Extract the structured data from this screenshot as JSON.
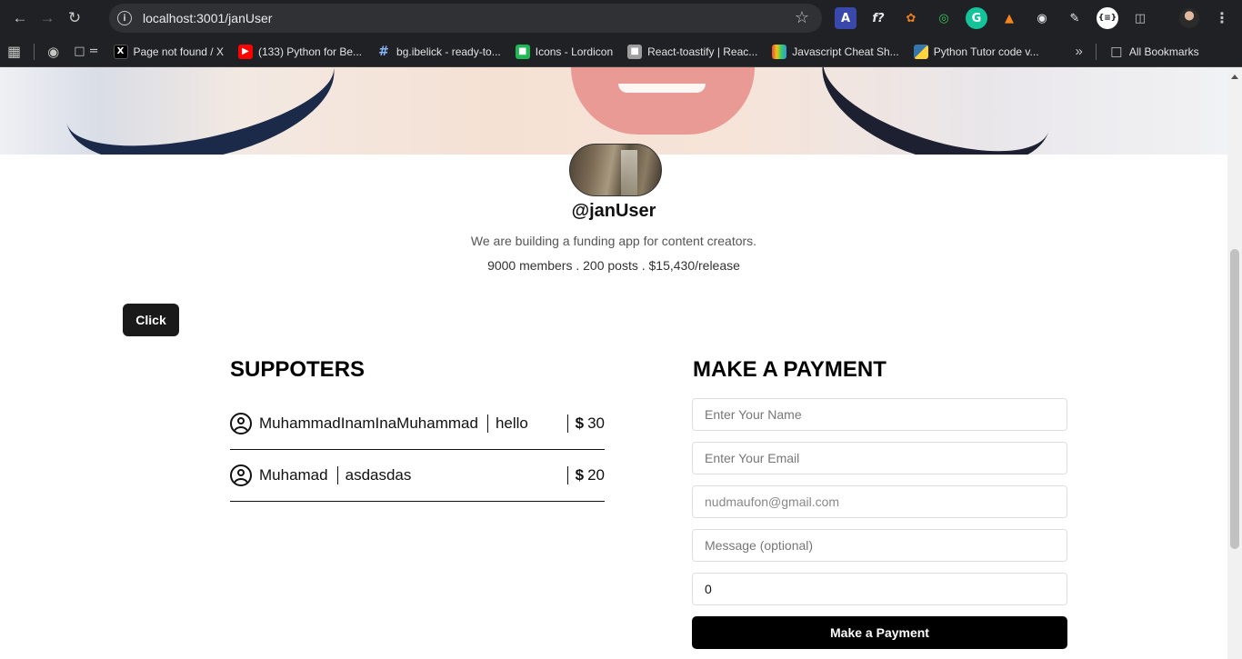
{
  "browser": {
    "url": "localhost:3001/janUser",
    "bookmarks": [
      {
        "label": "Page not found / X",
        "icon": "x-logo-icon"
      },
      {
        "label": "(133) Python for Be...",
        "icon": "youtube-icon"
      },
      {
        "label": "bg.ibelick - ready-to...",
        "icon": "hash-icon"
      },
      {
        "label": "Icons - Lordicon",
        "icon": "lordicon-icon"
      },
      {
        "label": "React-toastify | Reac...",
        "icon": "toastify-icon"
      },
      {
        "label": "Javascript Cheat Sh...",
        "icon": "cheatsheet-icon"
      },
      {
        "label": "Python Tutor code v...",
        "icon": "python-icon"
      }
    ],
    "more_label": "»",
    "all_bookmarks": "All Bookmarks"
  },
  "profile": {
    "handle": "@janUser",
    "bio": "We are building a funding app for content creators.",
    "stats": "9000 members . 200 posts . $15,430/release"
  },
  "click_button": "Click",
  "supporters": {
    "title": "SUPPOTERS",
    "rows": [
      {
        "name": "MuhammadInamInaMuhammad",
        "message": "hello",
        "amount": "30"
      },
      {
        "name": "Muhamad",
        "message": "asdasdas",
        "amount": "20"
      }
    ],
    "currency": "$"
  },
  "payment": {
    "title": "MAKE A PAYMENT",
    "name_placeholder": "Enter Your Name",
    "email_placeholder": "Enter Your Email",
    "email_value": "nudmaufon@gmail.com",
    "message_placeholder": "Message (optional)",
    "amount_value": "0",
    "button": "Make a Payment"
  }
}
